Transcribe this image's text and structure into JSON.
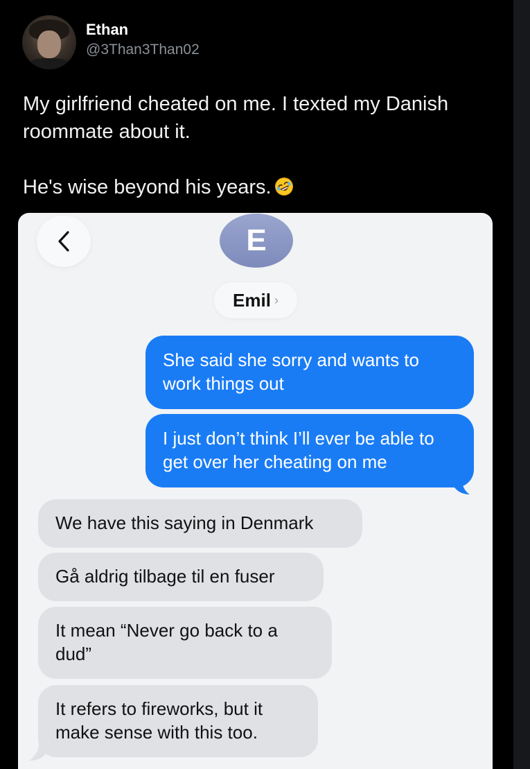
{
  "tweet": {
    "display_name": "Ethan",
    "handle": "@3Than3Than02",
    "text_line_1": "My girlfriend cheated on me. I texted my Danish roommate about it.",
    "text_line_2": "He's wise beyond his years.",
    "emoji_icon": "rolling-on-floor-laughing-emoji"
  },
  "conversation": {
    "contact_initial": "E",
    "contact_name": "Emil",
    "contact_chevron": "›",
    "back_icon": "chevron-left-icon",
    "messages": [
      {
        "direction": "sent",
        "text": "She said she sorry and wants to work things out"
      },
      {
        "direction": "sent",
        "text": "I just don’t think I’ll ever be able to get over her cheating on me"
      },
      {
        "direction": "received",
        "text": "We have this saying in Denmark"
      },
      {
        "direction": "received",
        "text": "Gå aldrig tilbage til en fuser"
      },
      {
        "direction": "received",
        "text": "It mean “Never go back to a dud”"
      },
      {
        "direction": "received",
        "text": "It refers to fireworks, but it make sense with this too."
      }
    ]
  },
  "colors": {
    "page_background": "#000000",
    "sent_bubble": "#1a7cf5",
    "received_bubble": "#dfe1e5",
    "contact_avatar": "#8f9bc8",
    "chat_background": "#f1f3f5"
  }
}
